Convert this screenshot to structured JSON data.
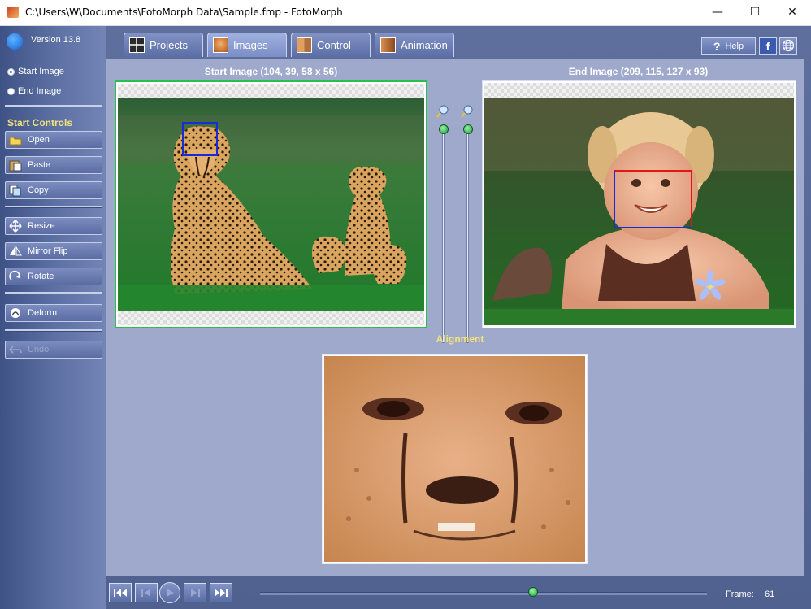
{
  "window": {
    "title": "C:\\Users\\W\\Documents\\FotoMorph Data\\Sample.fmp - FotoMorph",
    "minimize": "—",
    "maximize": "☐",
    "close": "✕"
  },
  "sidebar": {
    "version": "Version 13.8",
    "radios": [
      {
        "label": "Start Image",
        "selected": true
      },
      {
        "label": "End Image",
        "selected": false
      }
    ],
    "section_title": "Start Controls",
    "buttons": {
      "open": "Open",
      "paste": "Paste",
      "copy": "Copy",
      "resize": "Resize",
      "mirror_flip": "Mirror Flip",
      "rotate": "Rotate",
      "deform": "Deform",
      "undo": "Undo"
    }
  },
  "tabs": [
    {
      "label": "Projects",
      "icon": "grid-icon",
      "active": false
    },
    {
      "label": "Images",
      "icon": "image-icon",
      "active": true
    },
    {
      "label": "Control",
      "icon": "control-icon",
      "active": false
    },
    {
      "label": "Animation",
      "icon": "film-icon",
      "active": false
    }
  ],
  "header": {
    "help_label": "Help"
  },
  "main": {
    "start_caption": "Start Image (104, 39, 58 x 56)",
    "end_caption": "End Image (209, 115, 127 x 93)",
    "alignment_caption": "Alignment"
  },
  "playback": {
    "frame_label": "Frame:",
    "frame_value": "61",
    "position": 0.61
  },
  "colors": {
    "accent_green": "#26c04a",
    "caption_yellow": "#f2e27a",
    "selection_blue": "#1a2ad8",
    "selection_red": "#e01818"
  }
}
